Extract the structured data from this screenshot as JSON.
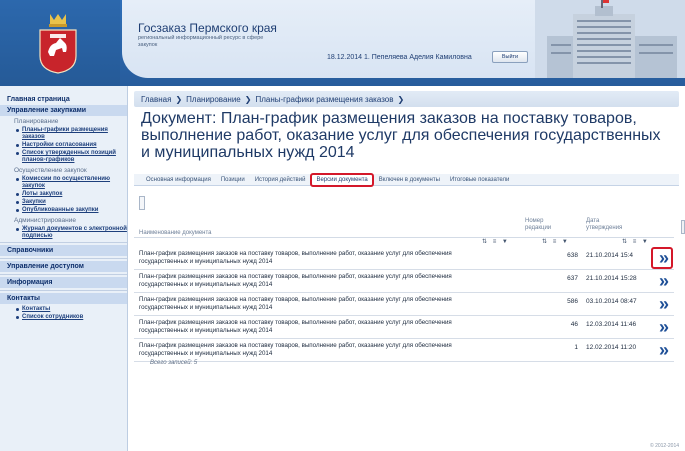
{
  "header": {
    "site_title": "Госзаказ Пермского края",
    "site_subtitle": "региональный информационный ресурс в сфере закупок",
    "user_line": "18.12.2014 1. Пепеляева Аделия Камиловна",
    "exit_label": "Выйти"
  },
  "sidebar": {
    "home": "Главная страница",
    "procurement": "Управление закупками",
    "planning_group": "Планирование",
    "planning_items": [
      "Планы-графики размещения заказов",
      "Настройки согласования",
      "Список утвержденных позиций планов-графиков"
    ],
    "execution_group": "Осуществление закупок",
    "execution_items": [
      "Комиссии по осуществлению закупок",
      "Лоты закупок",
      "Закупки",
      "Опубликованные закупки"
    ],
    "admin_group": "Администрирование",
    "admin_items": [
      "Журнал документов с электронной подписью"
    ],
    "references": "Справочники",
    "access": "Управление доступом",
    "info": "Информация",
    "contacts": "Контакты",
    "contacts_items": [
      "Контакты",
      "Список сотрудников"
    ]
  },
  "breadcrumb": [
    "Главная",
    "Планирование",
    "Планы-графики размещения заказов"
  ],
  "doc_title": "Документ: План-график размещения заказов на поставку товаров, выполнение работ, оказание услуг для обеспечения государственных и муниципальных нужд 2014",
  "tabs": [
    "Основная информация",
    "Позиции",
    "История действий",
    "Версии документа",
    "Включен в документы",
    "Итоговые показатели"
  ],
  "grid": {
    "col_name": "Наименование документа",
    "col_num": "Номер редакции",
    "col_date": "Дата утверждения",
    "filter_icons": "⇅ ≡ ▼",
    "go_glyph": "»",
    "rows": [
      {
        "name": "План-график размещения заказов на поставку товаров, выполнение работ, оказание услуг для обеспечения государственных и муниципальных нужд 2014",
        "num": "638",
        "date": "21.10.2014 15:4"
      },
      {
        "name": "План-график размещения заказов на поставку товаров, выполнение работ, оказание услуг для обеспечения государственных и муниципальных нужд 2014",
        "num": "637",
        "date": "21.10.2014 15:28"
      },
      {
        "name": "План-график размещения заказов на поставку товаров, выполнение работ, оказание услуг для обеспечения государственных и муниципальных нужд 2014",
        "num": "586",
        "date": "03.10.2014 08:47"
      },
      {
        "name": "План-график размещения заказов на поставку товаров, выполнение работ, оказание услуг для обеспечения государственных и муниципальных нужд 2014",
        "num": "46",
        "date": "12.03.2014 11:46"
      },
      {
        "name": "План-график размещения заказов на поставку товаров, выполнение работ, оказание услуг для обеспечения государственных и муниципальных нужд 2014",
        "num": "1",
        "date": "12.02.2014 11:20"
      }
    ],
    "total": "Всего записей: 5"
  },
  "footer": "© 2012-2014",
  "colors": {
    "accent": "#2f6fb8",
    "highlight_red": "#d4182a",
    "link": "#1d3f7c"
  }
}
